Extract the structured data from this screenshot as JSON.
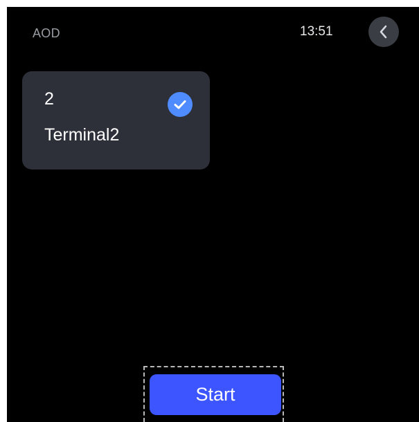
{
  "status_bar": {
    "label": "AOD",
    "time": "13:51",
    "back_icon": "chevron-left-icon"
  },
  "terminal_card": {
    "number": "2",
    "name": "Terminal2",
    "selected": true,
    "check_icon": "check-circle-icon"
  },
  "actions": {
    "start_label": "Start"
  },
  "colors": {
    "background": "#000000",
    "card": "#2e3039",
    "check": "#4f8cff",
    "start_button": "#3d55ff",
    "back_button": "#3b3d44"
  }
}
